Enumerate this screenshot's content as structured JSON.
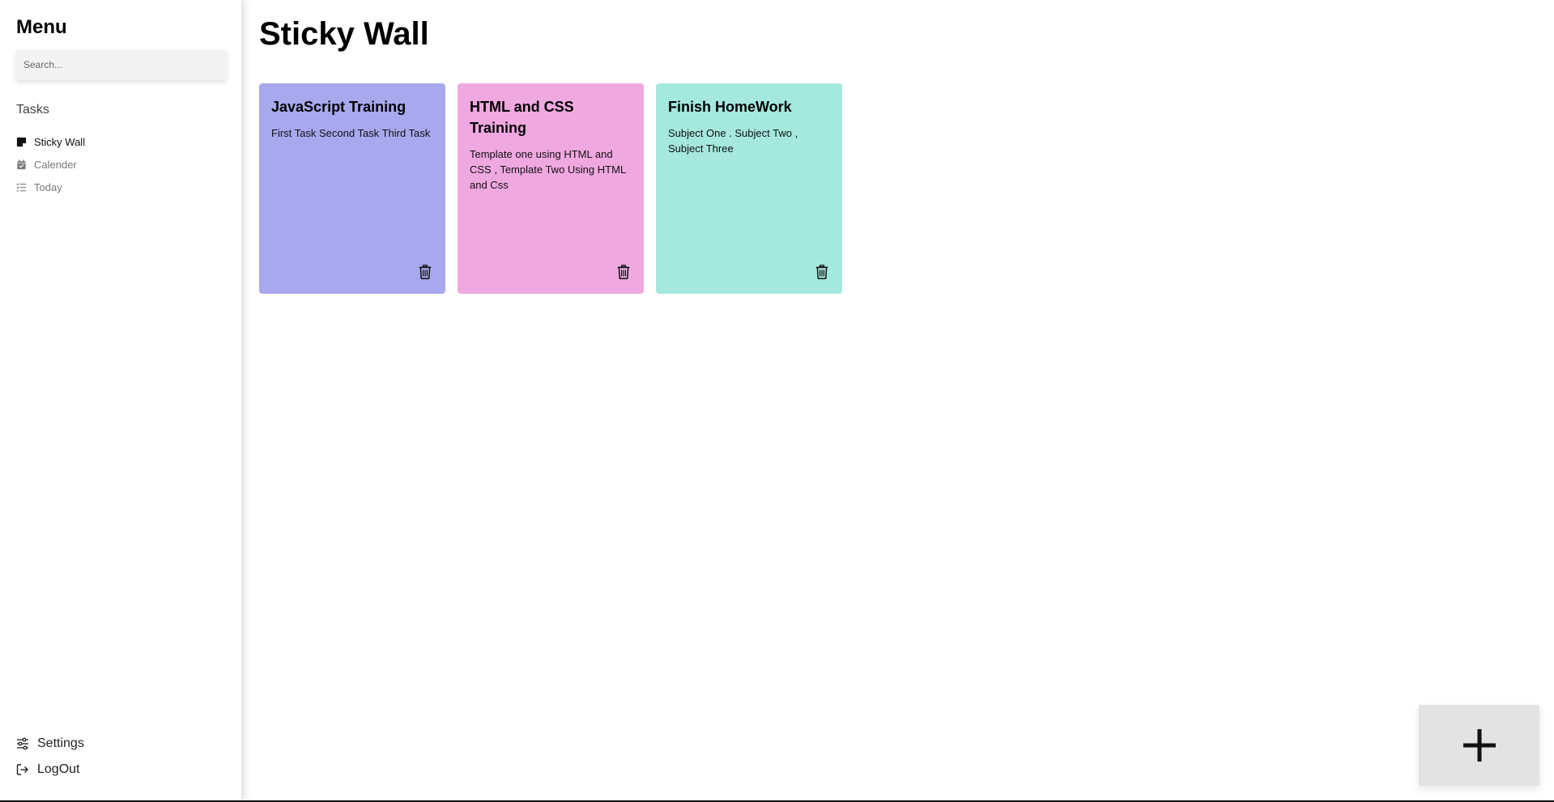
{
  "sidebar": {
    "title": "Menu",
    "search_placeholder": "Search...",
    "section_title": "Tasks",
    "items": [
      {
        "label": "Sticky Wall",
        "icon": "sticky-note-icon",
        "active": true
      },
      {
        "label": "Calender",
        "icon": "calendar-check-icon",
        "active": false
      },
      {
        "label": "Today",
        "icon": "list-check-icon",
        "active": false
      }
    ],
    "bottom_items": [
      {
        "label": "Settings",
        "icon": "sliders-icon"
      },
      {
        "label": "LogOut",
        "icon": "sign-out-icon"
      }
    ]
  },
  "main": {
    "title": "Sticky Wall",
    "cards": [
      {
        "title": "JavaScript Training",
        "body": "First Task Second Task Third Task",
        "color": "#a8a8ef",
        "delete_icon": "trash-icon"
      },
      {
        "title": "HTML and CSS Training",
        "body": "Template one using HTML and CSS , Template Two Using HTML and Css",
        "color": "#f0a8e0",
        "delete_icon": "trash-icon"
      },
      {
        "title": "Finish HomeWork",
        "body": "Subject One . Subject Two , Subject Three",
        "color": "#a4e8de",
        "delete_icon": "trash-icon"
      }
    ]
  },
  "add_button": {
    "icon": "plus-icon"
  }
}
